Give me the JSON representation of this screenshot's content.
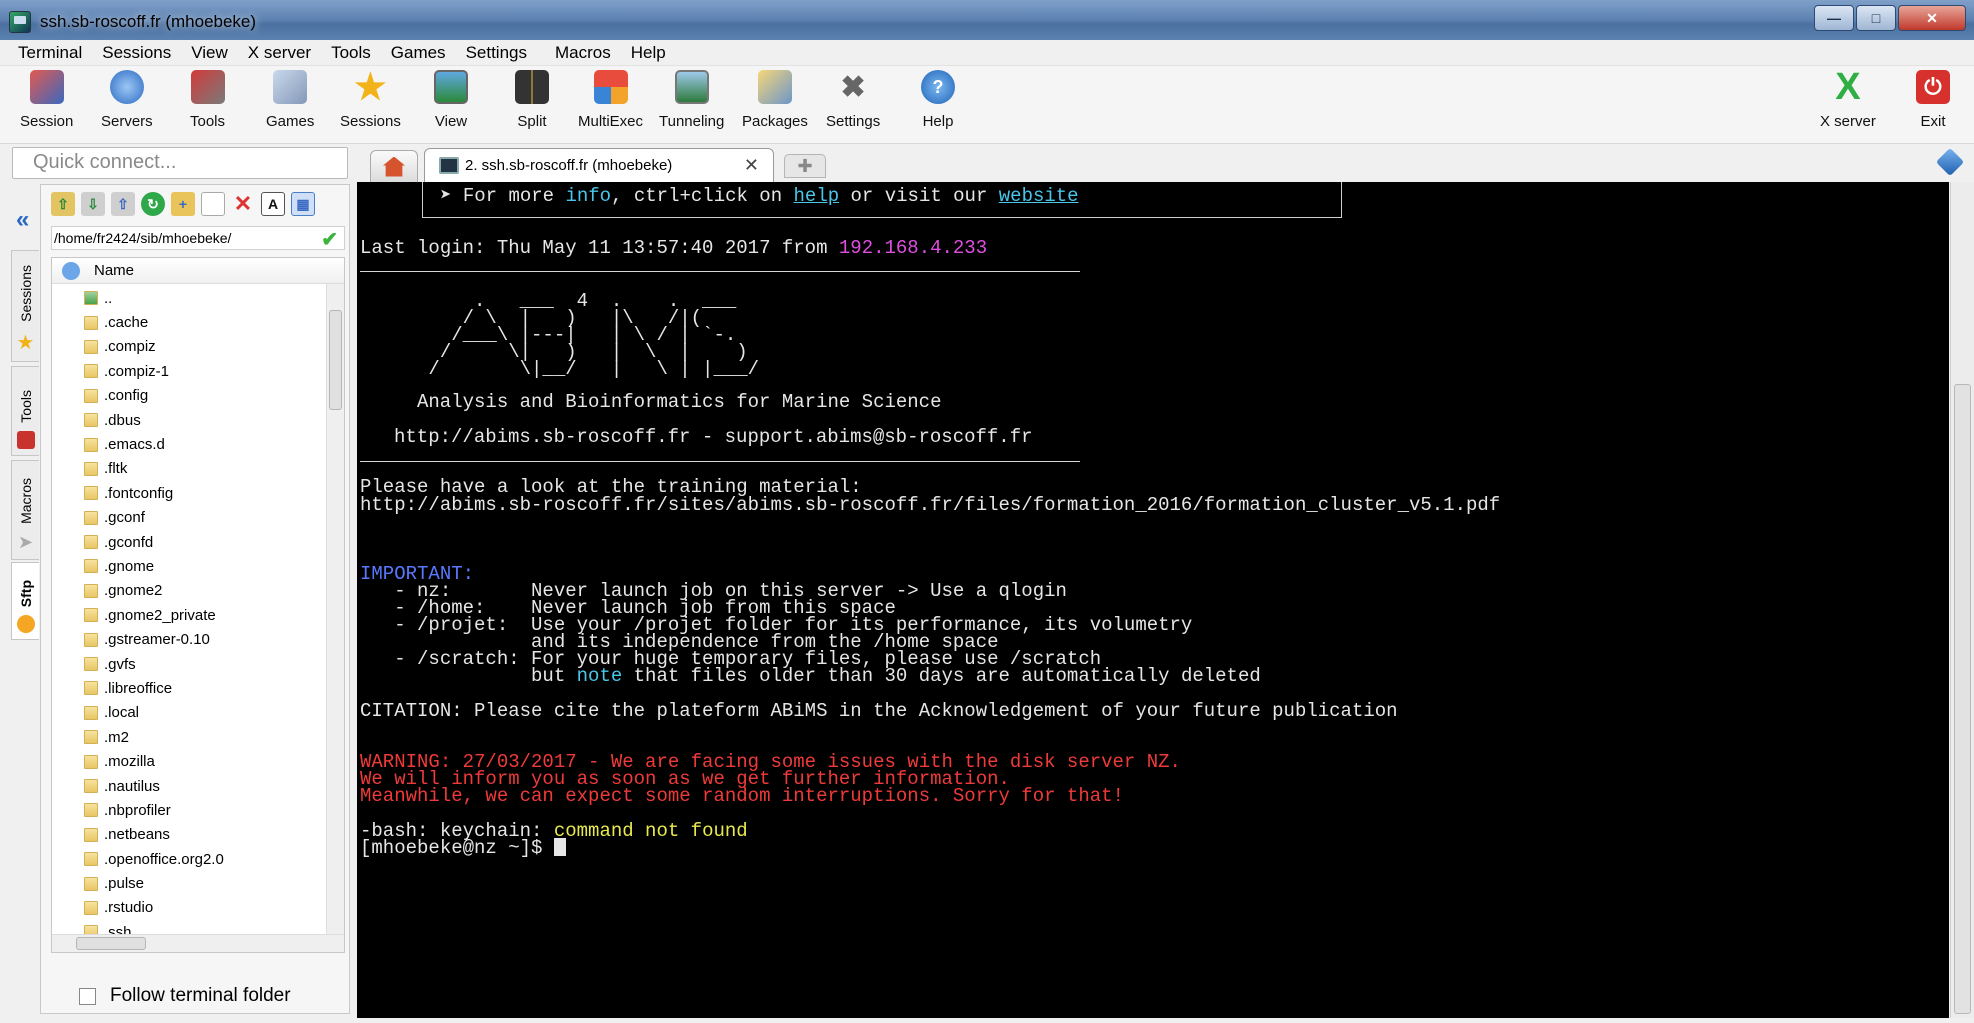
{
  "window": {
    "title": "ssh.sb-roscoff.fr (mhoebeke)"
  },
  "menu": [
    "Terminal",
    "Sessions",
    "View",
    "X server",
    "Tools",
    "Games",
    "Settings",
    "Macros",
    "Help"
  ],
  "toolbar": {
    "session": "Session",
    "servers": "Servers",
    "tools": "Tools",
    "games": "Games",
    "sessions": "Sessions",
    "view": "View",
    "split": "Split",
    "multiexec": "MultiExec",
    "tunneling": "Tunneling",
    "packages": "Packages",
    "settings": "Settings",
    "help": "Help",
    "xserver": "X server",
    "exit": "Exit"
  },
  "quick_connect": {
    "placeholder": "Quick connect..."
  },
  "tabs": {
    "active_label": "2. ssh.sb-roscoff.fr (mhoebeke)"
  },
  "side_tabs": {
    "sessions": "Sessions",
    "tools": "Tools",
    "macros": "Macros",
    "sftp": "Sftp"
  },
  "sftp": {
    "path": "/home/fr2424/sib/mhoebeke/",
    "column_name": "Name",
    "files": [
      "..",
      ".cache",
      ".compiz",
      ".compiz-1",
      ".config",
      ".dbus",
      ".emacs.d",
      ".fltk",
      ".fontconfig",
      ".gconf",
      ".gconfd",
      ".gnome",
      ".gnome2",
      ".gnome2_private",
      ".gstreamer-0.10",
      ".gvfs",
      ".libreoffice",
      ".local",
      ".m2",
      ".mozilla",
      ".nautilus",
      ".nbprofiler",
      ".netbeans",
      ".openoffice.org2.0",
      ".pulse",
      ".rstudio",
      ".ssh"
    ],
    "follow_label": "Follow terminal folder"
  },
  "terminal": {
    "info_prefix": "➤ For more ",
    "info_word": "info",
    "info_middle": ", ctrl+click on ",
    "info_help": "help",
    "info_or": " or visit our ",
    "info_website": "website",
    "last_login_text": "Last login: Thu May 11 13:57:40 2017 from ",
    "last_login_ip": "192.168.4.233",
    "logo_lines": [
      "          .   ___  4  .    .  ___",
      "         / \\  |   )   |\\   /|(",
      "        /___\\ |---|   | \\ / | `-.",
      "       /     \\|   )   |  \\  |    )",
      "      /       \\|__/   |   \\ | |___/"
    ],
    "tagline": "Analysis and Bioinformatics for Marine Science",
    "contact": "http://abims.sb-roscoff.fr - support.abims@sb-roscoff.fr",
    "training_intro": "Please have a look at the training material:",
    "training_url": "http://abims.sb-roscoff.fr/sites/abims.sb-roscoff.fr/files/formation_2016/formation_cluster_v5.1.pdf",
    "important_head": "IMPORTANT:",
    "important_lines": [
      "   - nz:       Never launch job on this server -> Use a qlogin",
      "   - /home:    Never launch job from this space",
      "   - /projet:  Use your /projet folder for its performance, its volumetry",
      "               and its independence from the /home space",
      "   - /scratch: For your huge temporary files, please use /scratch"
    ],
    "note_prefix": "               but ",
    "note_word": "note",
    "note_suffix": " that files older than 30 days are automatically deleted",
    "citation": "CITATION: Please cite the plateform ABiMS in the Acknowledgement of your future publication",
    "warning_lines": [
      "WARNING: 27/03/2017 - We are facing some issues with the disk server NZ.",
      "We will inform you as soon as we get further information.",
      "Meanwhile, we can expect some random interruptions. Sorry for that!"
    ],
    "bash_prefix": "-bash: keychain: ",
    "bash_error": "command not found",
    "prompt": "[mhoebeke@nz ~]$ "
  }
}
